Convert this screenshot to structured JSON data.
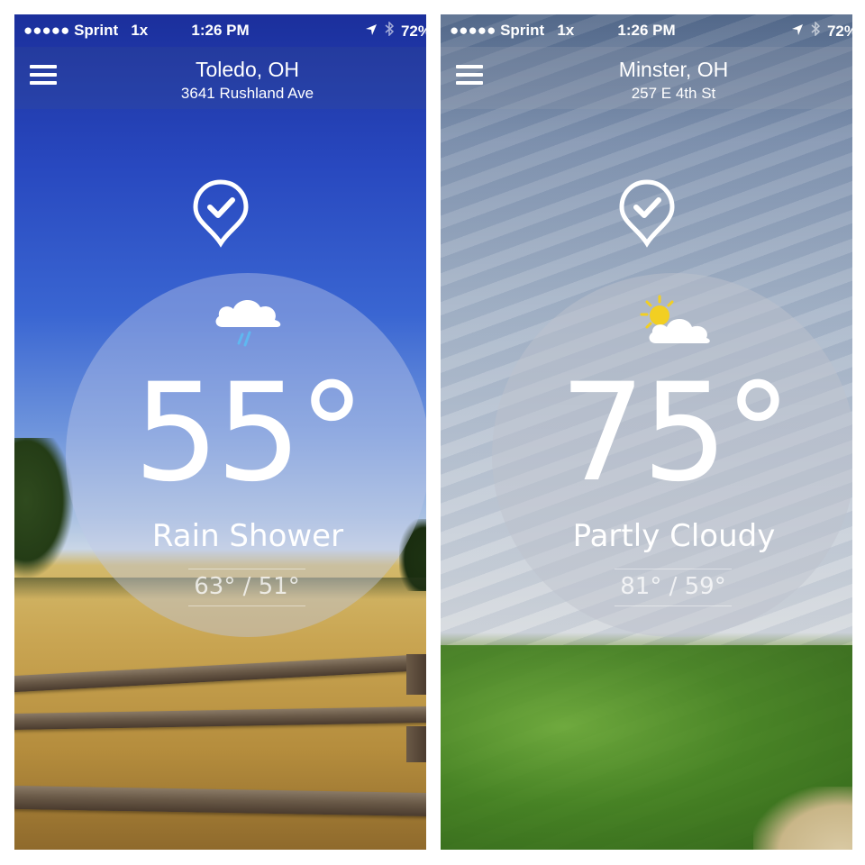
{
  "screens": [
    {
      "status": {
        "carrier": "●●●●● Sprint",
        "network": "1x",
        "time": "1:26 PM",
        "battery": "72%"
      },
      "header": {
        "city": "Toledo, OH",
        "address": "3641 Rushland Ave"
      },
      "icons": {
        "menu": "hamburger-menu-icon",
        "pin": "location-check-pin-icon",
        "condition": "rain-cloud-icon"
      },
      "weather": {
        "temperature": "55°",
        "condition": "Rain Shower",
        "high_low": "63° / 51°"
      }
    },
    {
      "status": {
        "carrier": "●●●●● Sprint",
        "network": "1x",
        "time": "1:26 PM",
        "battery": "72%"
      },
      "header": {
        "city": "Minster, OH",
        "address": "257 E 4th St"
      },
      "icons": {
        "menu": "hamburger-menu-icon",
        "pin": "location-check-pin-icon",
        "condition": "partly-cloudy-icon"
      },
      "weather": {
        "temperature": "75°",
        "condition": "Partly Cloudy",
        "high_low": "81° / 59°"
      }
    }
  ],
  "colors": {
    "text": "#ffffff",
    "sun": "#f2cf22",
    "rain": "#5fb8f0"
  }
}
